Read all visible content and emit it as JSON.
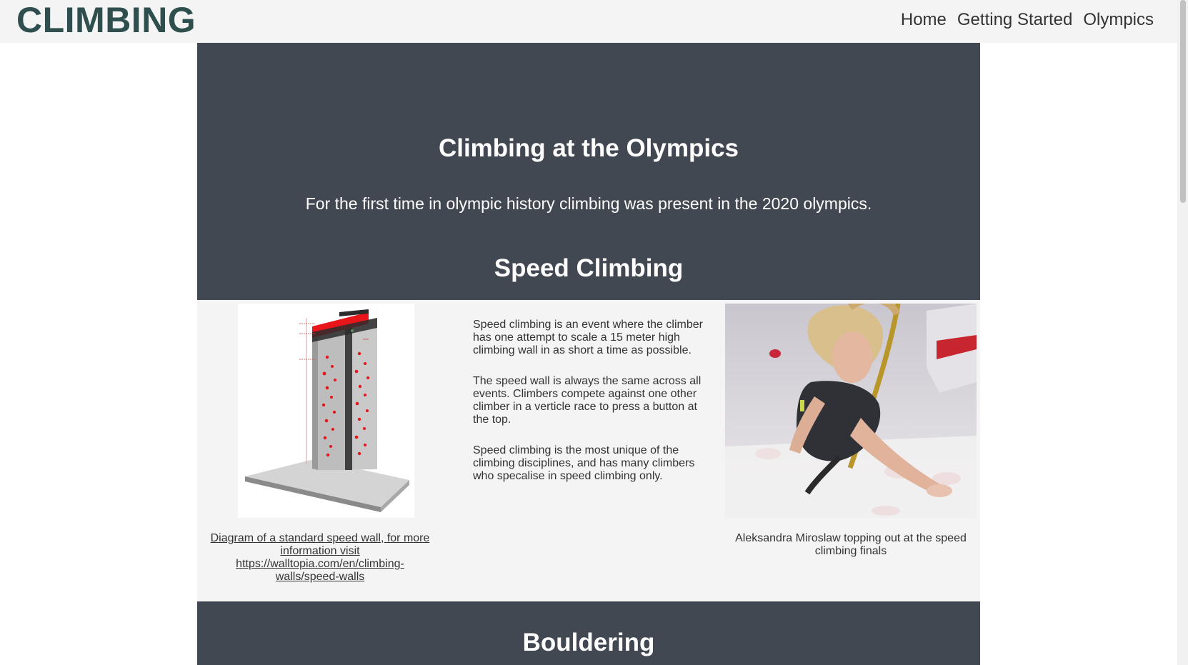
{
  "header": {
    "brand": "CLIMBING",
    "nav": [
      "Home",
      "Getting Started",
      "Olympics"
    ]
  },
  "hero": {
    "title": "Climbing at the Olympics",
    "lead": "For the first time in olympic history climbing was present in the 2020 olympics.",
    "section_title": "Speed Climbing"
  },
  "speed": {
    "diagram_caption": "Diagram of a standard speed wall, for more information visit https://walltopia.com/en/climbing-walls/speed-walls",
    "paragraphs": [
      "Speed climbing is an event where the climber has one attempt to scale a 15 meter high climbing wall in as short a time as possible.",
      "The speed wall is always the same across all events. Climbers compete against one other climber in a verticle race to press a button at the top.",
      "Speed climbing is the most unique of the climbing disciplines, and has many climbers who specalise in speed climbing only."
    ],
    "photo_caption": "Aleksandra Miroslaw topping out at the speed climbing finals"
  },
  "next_section": {
    "title": "Bouldering"
  },
  "colors": {
    "header_bg": "#f4f4f4",
    "brand": "#2f4f4f",
    "section_dark": "#424852",
    "panel_light": "#f4f4f4",
    "accent_red": "#e8151b"
  }
}
